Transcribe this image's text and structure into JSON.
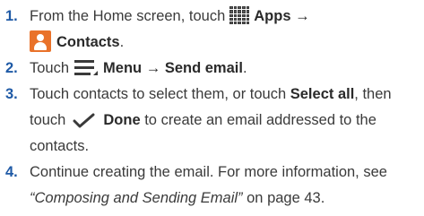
{
  "steps": [
    {
      "number": "1.",
      "line1_text": "From the Home screen, touch",
      "apps_label": "Apps",
      "arrow": "→",
      "contacts_label": "Contacts",
      "contacts_period": ".",
      "icons": [
        "apps-grid-icon",
        "contacts-app-icon"
      ]
    },
    {
      "number": "2.",
      "touch": "Touch",
      "menu_label": "Menu",
      "arrow": "→",
      "send_email": "Send email",
      "period": ".",
      "icons": [
        "menu-icon"
      ]
    },
    {
      "number": "3.",
      "line1_a": "Touch contacts to select them, or touch",
      "select_all": "Select all",
      "line1_b": ", then",
      "line2_a": "touch",
      "done_label": "Done",
      "line2_b": "to create an email addressed to the",
      "line3": "contacts.",
      "icons": [
        "checkmark-icon"
      ]
    },
    {
      "number": "4.",
      "line1": "Continue creating the email. For more information, see",
      "ref_title": "“Composing and Sending Email”",
      "line2_b": " on page 43."
    }
  ],
  "colors": {
    "step_number": "#1f5aa6",
    "body_text": "#3a3a3a",
    "contacts_icon": "#e9722a"
  }
}
